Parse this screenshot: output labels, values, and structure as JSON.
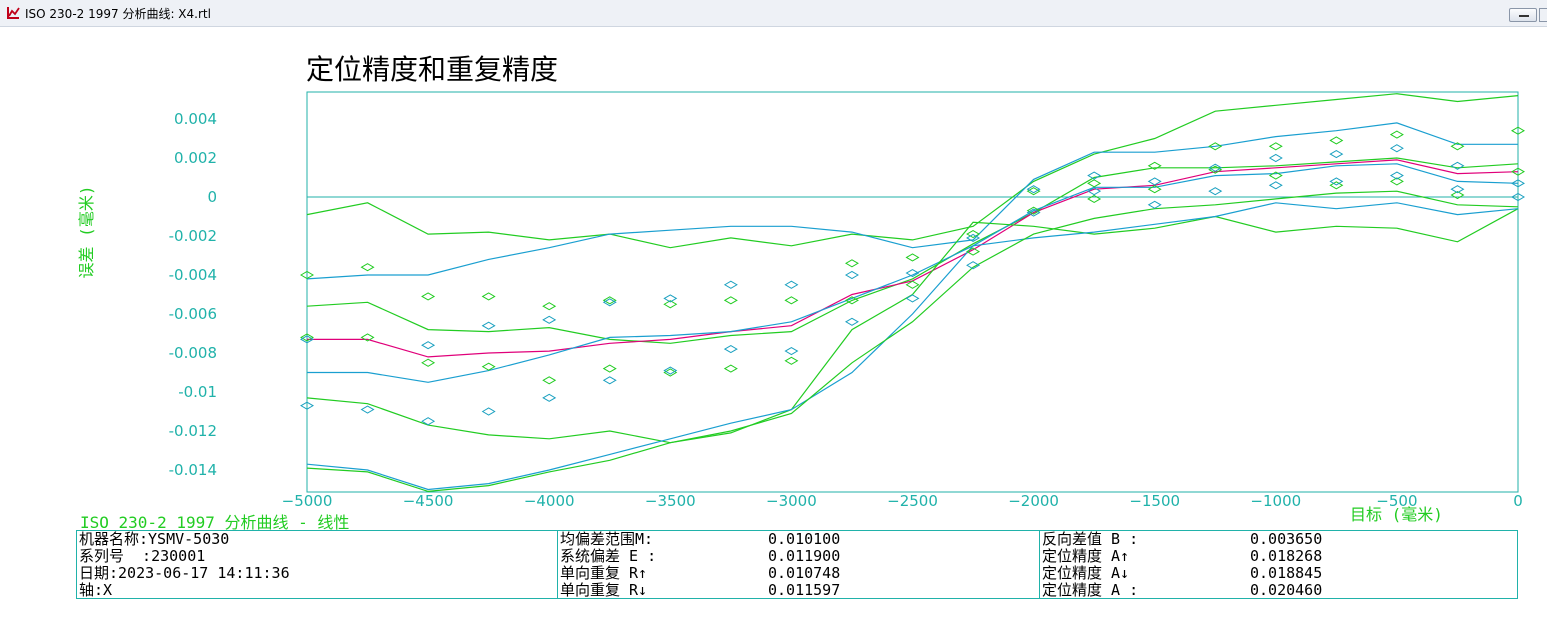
{
  "window": {
    "title": "ISO 230-2 1997 分析曲线: X4.rtl",
    "icon": "chart-app-icon"
  },
  "chart_title": "定位精度和重复精度",
  "analysis_label": "ISO 230-2 1997 分析曲线 - 线性",
  "axes": {
    "ylabel": "误差 (毫米)",
    "xlabel": "目标 (毫米)",
    "y_ticks": [
      "0.004",
      "0.002",
      "0",
      "-0.002",
      "-0.004",
      "-0.006",
      "-0.008",
      "-0.01",
      "-0.012",
      "-0.014"
    ],
    "x_ticks": [
      "−5000",
      "−4500",
      "−4000",
      "−3500",
      "−3000",
      "−2500",
      "−2000",
      "−1500",
      "−1000",
      "−500",
      "0"
    ]
  },
  "colors": {
    "axis": "#20b2aa",
    "green": "#22cc22",
    "mean": "#e0007a",
    "blue": "#1a9fd0",
    "point_cyan": "#1aa0c0"
  },
  "chart_data": {
    "type": "line",
    "xlim": [
      -5000,
      0
    ],
    "ylim": [
      -0.015,
      0.0053
    ],
    "grid": false,
    "x": [
      -5000,
      -4750,
      -4500,
      -4250,
      -4000,
      -3750,
      -3500,
      -3250,
      -3000,
      -2750,
      -2500,
      -2250,
      -2000,
      -1750,
      -1500,
      -1250,
      -1000,
      -750,
      -500,
      -250,
      0
    ],
    "series": [
      {
        "role": "green-upper-outer",
        "color": "#22cc22",
        "values": [
          -0.0009,
          -0.0003,
          -0.0019,
          -0.0018,
          -0.0022,
          -0.0019,
          -0.0026,
          -0.0021,
          -0.0025,
          -0.0019,
          -0.0022,
          -0.0015,
          0.0008,
          0.0022,
          0.003,
          0.0044,
          0.0047,
          0.005,
          0.0053,
          0.0049,
          0.0052
        ]
      },
      {
        "role": "blue-upper",
        "color": "#1a9fd0",
        "values": [
          -0.0042,
          -0.004,
          -0.004,
          -0.0032,
          -0.0026,
          -0.0019,
          -0.0017,
          -0.0015,
          -0.0015,
          -0.0018,
          -0.0026,
          -0.0022,
          0.0009,
          0.0023,
          0.0023,
          0.0026,
          0.0031,
          0.0034,
          0.0038,
          0.0027,
          0.0027
        ]
      },
      {
        "role": "green-upper-inner",
        "color": "#22cc22",
        "values": [
          -0.0056,
          -0.0054,
          -0.0068,
          -0.0069,
          -0.0067,
          -0.0073,
          -0.0075,
          -0.0071,
          -0.0069,
          -0.0053,
          -0.0042,
          -0.0024,
          -0.0008,
          0.001,
          0.0015,
          0.0015,
          0.0016,
          0.0018,
          0.002,
          0.0015,
          0.0017
        ]
      },
      {
        "role": "mean",
        "color": "#e0007a",
        "values": [
          -0.0073,
          -0.0073,
          -0.0082,
          -0.008,
          -0.0079,
          -0.0075,
          -0.0073,
          -0.0069,
          -0.0066,
          -0.005,
          -0.0043,
          -0.0027,
          -0.0008,
          0.0004,
          0.0006,
          0.0013,
          0.0015,
          0.0017,
          0.0019,
          0.0012,
          0.0013
        ]
      },
      {
        "role": "blue-lower",
        "color": "#1a9fd0",
        "values": [
          -0.009,
          -0.009,
          -0.0095,
          -0.0089,
          -0.0081,
          -0.0072,
          -0.0071,
          -0.0069,
          -0.0064,
          -0.0052,
          -0.004,
          -0.0025,
          -0.0007,
          0.0005,
          0.0005,
          0.0011,
          0.0012,
          0.0016,
          0.0017,
          0.0008,
          0.0007
        ]
      },
      {
        "role": "green-lower-inner",
        "color": "#22cc22",
        "values": [
          -0.0103,
          -0.0106,
          -0.0117,
          -0.0122,
          -0.0124,
          -0.012,
          -0.0126,
          -0.0121,
          -0.0109,
          -0.0068,
          -0.005,
          -0.0013,
          -0.0015,
          -0.0019,
          -0.0016,
          -0.001,
          -0.0018,
          -0.0015,
          -0.0016,
          -0.0023,
          -0.0006
        ]
      },
      {
        "role": "blue-lowest",
        "color": "#1a9fd0",
        "values": [
          -0.0137,
          -0.014,
          -0.015,
          -0.0147,
          -0.014,
          -0.0132,
          -0.0124,
          -0.0116,
          -0.0109,
          -0.009,
          -0.006,
          -0.0025,
          -0.0021,
          -0.0018,
          -0.0014,
          -0.001,
          -0.0003,
          -0.0006,
          -0.0003,
          -0.0009,
          -0.0006
        ]
      },
      {
        "role": "green-lowest",
        "color": "#22cc22",
        "values": [
          -0.0139,
          -0.0141,
          -0.0151,
          -0.0148,
          -0.0141,
          -0.0135,
          -0.0126,
          -0.012,
          -0.0111,
          -0.0085,
          -0.0064,
          -0.0036,
          -0.0019,
          -0.0011,
          -0.0006,
          -0.0004,
          -0.0001,
          0.0002,
          0.0003,
          -0.0004,
          -0.0005
        ]
      }
    ],
    "points_green": [
      [
        -5000,
        -0.004
      ],
      [
        -5000,
        -0.0072
      ],
      [
        -4750,
        -0.0036
      ],
      [
        -4750,
        -0.0072
      ],
      [
        -4500,
        -0.0051
      ],
      [
        -4500,
        -0.0085
      ],
      [
        -4250,
        -0.0051
      ],
      [
        -4250,
        -0.0087
      ],
      [
        -4000,
        -0.0056
      ],
      [
        -4000,
        -0.0094
      ],
      [
        -3750,
        -0.0053
      ],
      [
        -3750,
        -0.0088
      ],
      [
        -3500,
        -0.0055
      ],
      [
        -3500,
        -0.009
      ],
      [
        -3250,
        -0.0053
      ],
      [
        -3250,
        -0.0088
      ],
      [
        -3000,
        -0.0053
      ],
      [
        -3000,
        -0.0084
      ],
      [
        -2750,
        -0.0034
      ],
      [
        -2750,
        -0.0053
      ],
      [
        -2500,
        -0.0031
      ],
      [
        -2500,
        -0.0045
      ],
      [
        -2250,
        -0.0019
      ],
      [
        -2250,
        -0.0028
      ],
      [
        -2000,
        0.0003
      ],
      [
        -2000,
        -0.0007
      ],
      [
        -1750,
        0.0007
      ],
      [
        -1750,
        -0.0001
      ],
      [
        -1500,
        0.0016
      ],
      [
        -1500,
        0.0004
      ],
      [
        -1250,
        0.0026
      ],
      [
        -1250,
        0.0014
      ],
      [
        -1000,
        0.0026
      ],
      [
        -1000,
        0.0011
      ],
      [
        -750,
        0.0029
      ],
      [
        -750,
        0.0006
      ],
      [
        -500,
        0.0032
      ],
      [
        -500,
        0.0008
      ],
      [
        -250,
        0.0026
      ],
      [
        -250,
        0.0001
      ],
      [
        0,
        0.0034
      ],
      [
        0,
        0.0013
      ]
    ],
    "points_cyan": [
      [
        -5000,
        -0.0107
      ],
      [
        -5000,
        -0.0073
      ],
      [
        -4750,
        -0.0109
      ],
      [
        -4500,
        -0.0115
      ],
      [
        -4500,
        -0.0076
      ],
      [
        -4250,
        -0.011
      ],
      [
        -4250,
        -0.0066
      ],
      [
        -4000,
        -0.0103
      ],
      [
        -4000,
        -0.0063
      ],
      [
        -3750,
        -0.0094
      ],
      [
        -3750,
        -0.0054
      ],
      [
        -3500,
        -0.0089
      ],
      [
        -3500,
        -0.0052
      ],
      [
        -3250,
        -0.0078
      ],
      [
        -3250,
        -0.0045
      ],
      [
        -3000,
        -0.0079
      ],
      [
        -3000,
        -0.0045
      ],
      [
        -2750,
        -0.0064
      ],
      [
        -2750,
        -0.004
      ],
      [
        -2500,
        -0.0052
      ],
      [
        -2500,
        -0.0039
      ],
      [
        -2250,
        -0.0035
      ],
      [
        -2250,
        -0.0021
      ],
      [
        -2000,
        -0.0008
      ],
      [
        -2000,
        0.0004
      ],
      [
        -1750,
        0.0011
      ],
      [
        -1750,
        0.0003
      ],
      [
        -1500,
        0.0008
      ],
      [
        -1500,
        -0.0004
      ],
      [
        -1250,
        0.0015
      ],
      [
        -1250,
        0.0003
      ],
      [
        -1000,
        0.002
      ],
      [
        -1000,
        0.0006
      ],
      [
        -750,
        0.0022
      ],
      [
        -750,
        0.0008
      ],
      [
        -500,
        0.0025
      ],
      [
        -500,
        0.0011
      ],
      [
        -250,
        0.0016
      ],
      [
        -250,
        0.0004
      ],
      [
        0,
        0.0007
      ],
      [
        0,
        0.0
      ]
    ]
  },
  "info": {
    "col1": [
      {
        "k": "机器名称:YSMV-5030"
      },
      {
        "k": "系列号  :230001"
      },
      {
        "k": "日期:2023-06-17 14:11:36"
      },
      {
        "k": "轴:X"
      }
    ],
    "col2": [
      {
        "k": "均偏差范围M:",
        "v": "0.010100"
      },
      {
        "k": "系统偏差 E :",
        "v": "0.011900"
      },
      {
        "k": "单向重复 R↑",
        "v": "0.010748"
      },
      {
        "k": "单向重复 R↓",
        "v": "0.011597"
      }
    ],
    "col3": [
      {
        "k": "反向差值 B :",
        "v": "0.003650"
      },
      {
        "k": "定位精度 A↑",
        "v": "0.018268"
      },
      {
        "k": "定位精度 A↓",
        "v": "0.018845"
      },
      {
        "k": "定位精度 A :",
        "v": "0.020460"
      }
    ]
  }
}
